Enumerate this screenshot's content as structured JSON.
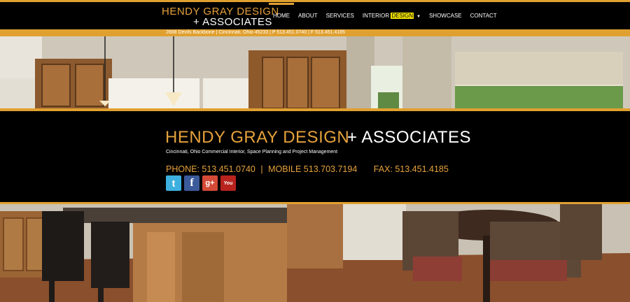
{
  "header": {
    "logo_line1": "HENDY GRAY DESIGN",
    "logo_line2": "+ ASSOCIATES",
    "nav": [
      {
        "label": "HOME"
      },
      {
        "label": "ABOUT"
      },
      {
        "label": "SERVICES"
      },
      {
        "label_prefix": "INTERIOR ",
        "label_highlight": "DESIGN"
      },
      {
        "label": "SHOWCASE"
      },
      {
        "label": "CONTACT"
      }
    ],
    "address": "2668 Devils Backbone | Cincinnati, Ohio 45233 | P 513.451.0740 | F 513.451.4185"
  },
  "band": {
    "title_gold": "HENDY GRAY DESIGN",
    "title_white": "+ ASSOCIATES",
    "tagline": "Cincinnati, Ohio Commercial Interior, Space Planning and Project Management",
    "phone": "PHONE: 513.451.0740",
    "separator": "|",
    "mobile": "MOBILE 513.703.7194",
    "fax": "FAX: 513.451.4185",
    "social": {
      "twitter_glyph": "t",
      "facebook_glyph": "f",
      "googleplus_glyph": "g+",
      "youtube_glyph": "You"
    }
  },
  "colors": {
    "accent": "#e0a030",
    "background": "#000000",
    "highlight": "#f3e300"
  }
}
